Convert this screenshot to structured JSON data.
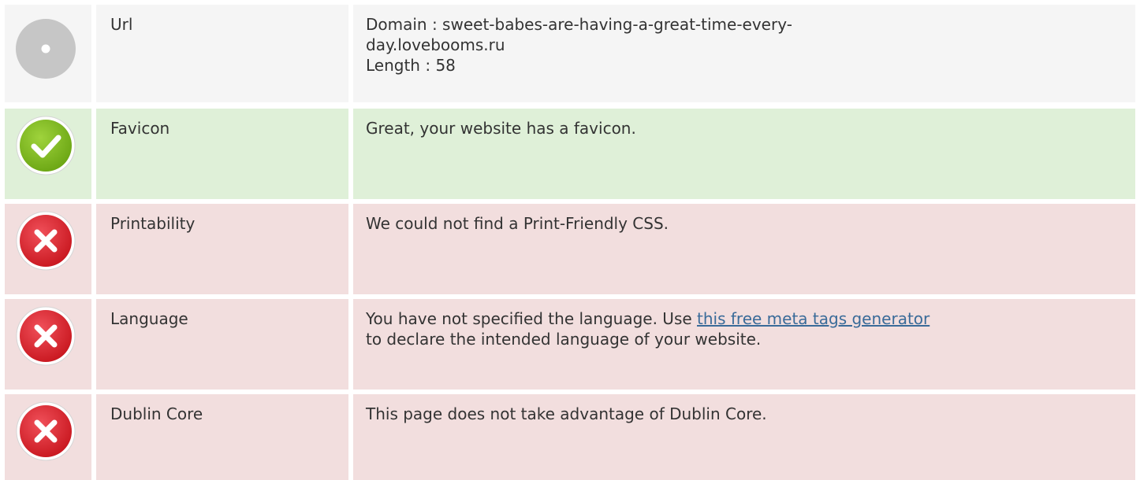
{
  "rows": [
    {
      "label": "Url",
      "value_lines": [
        "Domain : sweet-babes-are-having-a-great-time-every-",
        "day.lovebooms.ru",
        "Length : 58"
      ],
      "status": "neutral",
      "icon": "neutral-circle-icon"
    },
    {
      "label": "Favicon",
      "value": "Great, your website has a favicon.",
      "status": "good",
      "icon": "green-check-icon"
    },
    {
      "label": "Printability",
      "value": "We could not find a Print-Friendly CSS.",
      "status": "bad",
      "icon": "red-x-icon"
    },
    {
      "label": "Language",
      "value_prefix": "You have not specified the language. Use ",
      "link_text": "this free meta tags generator",
      "value_suffix": "to declare the intended language of your website.",
      "status": "bad",
      "icon": "red-x-icon"
    },
    {
      "label": "Dublin Core",
      "value": "This page does not take advantage of Dublin Core.",
      "status": "bad",
      "icon": "red-x-icon"
    }
  ],
  "colors": {
    "neutral_bg": "#f5f5f5",
    "good_bg": "#dff0d8",
    "bad_bg": "#f2dede",
    "link": "#3a6b99",
    "text": "#333333"
  }
}
